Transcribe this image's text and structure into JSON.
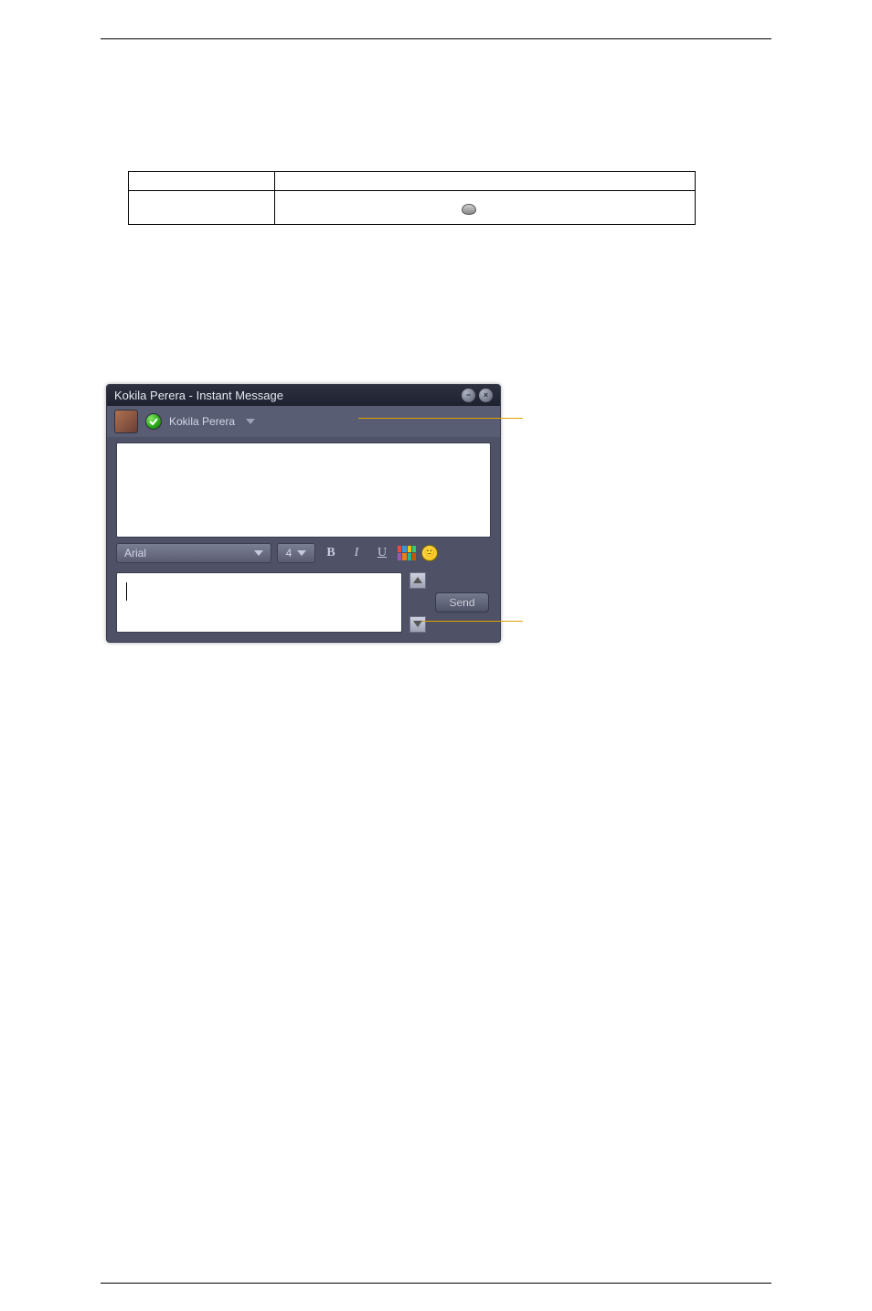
{
  "doc_table": {
    "row1": {
      "a": "",
      "b": ""
    },
    "row2": {
      "a": "",
      "b": ""
    }
  },
  "im": {
    "window_title": "Kokila Perera - Instant Message",
    "contact_name": "Kokila Perera",
    "font_name": "Arial",
    "font_size": "4",
    "bold_label": "B",
    "italic_label": "I",
    "underline_label": "U",
    "send_label": "Send"
  }
}
